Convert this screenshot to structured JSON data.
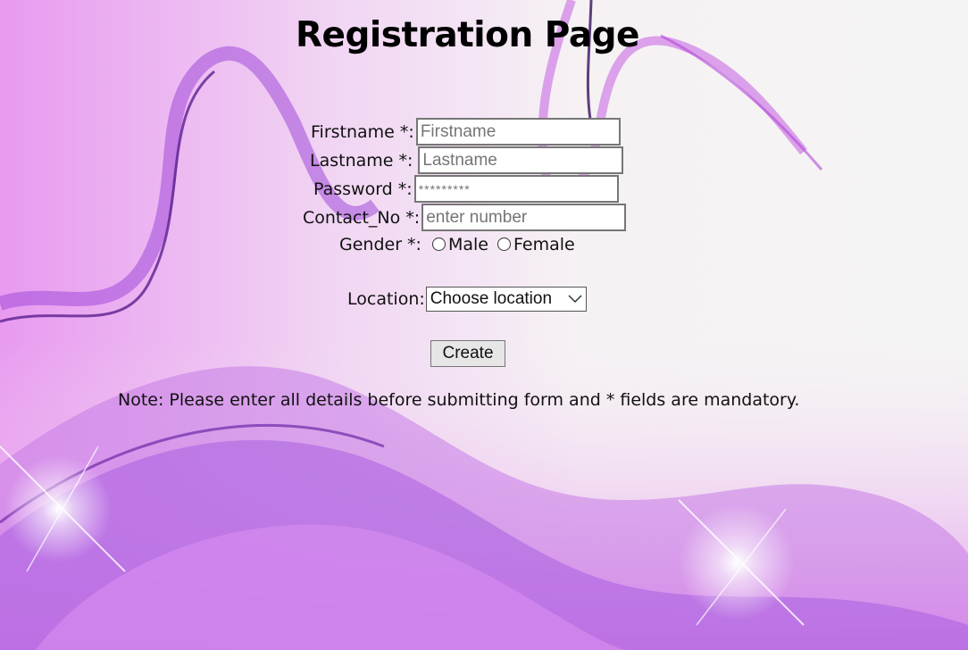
{
  "page": {
    "title": "Registration Page"
  },
  "form": {
    "firstname": {
      "label": "Firstname *:",
      "placeholder": "Firstname",
      "value": ""
    },
    "lastname": {
      "label": "Lastname *:",
      "placeholder": "Lastname",
      "value": ""
    },
    "password": {
      "label": "Password *:",
      "placeholder": "*********",
      "value": ""
    },
    "contact": {
      "label": "Contact_No *:",
      "placeholder": "enter number",
      "value": ""
    },
    "gender": {
      "label": "Gender *:",
      "options": [
        "Male",
        "Female"
      ]
    },
    "location": {
      "label": "Location:",
      "selected": "Choose location"
    },
    "submit_label": "Create"
  },
  "note": "Note: Please enter all details before submitting form and * fields are mandatory.",
  "colors": {
    "background": "#f4f1f3",
    "accent_purple": "#9b3fd6",
    "accent_magenta": "#d74fe0"
  }
}
